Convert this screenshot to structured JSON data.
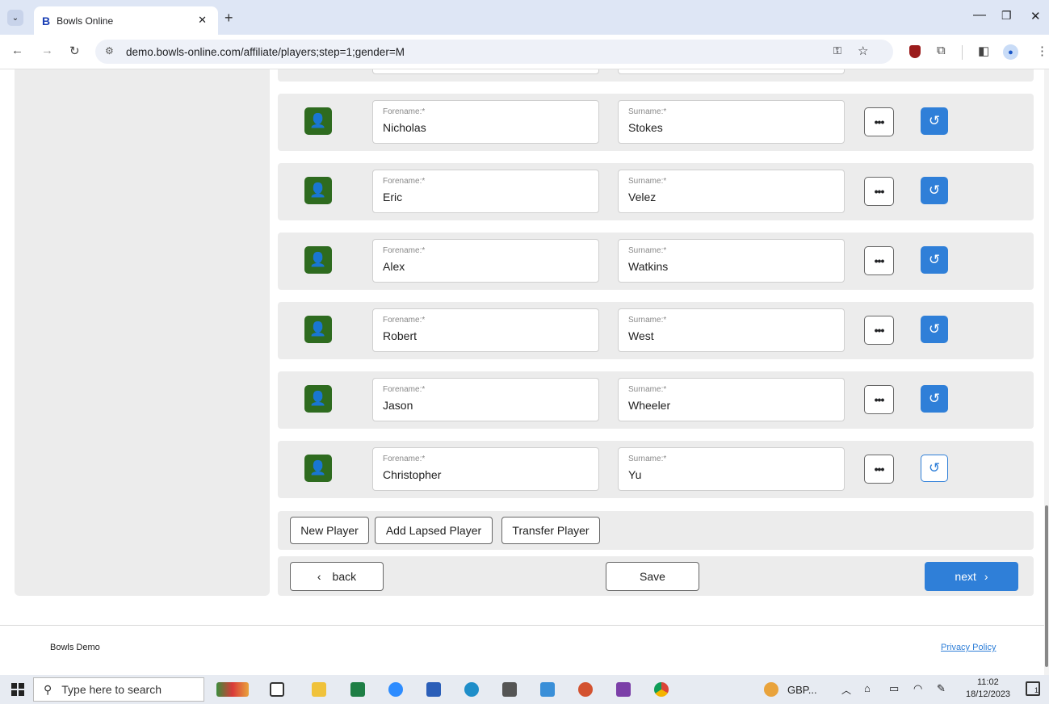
{
  "browser": {
    "tab_title": "Bowls Online",
    "tab_favicon": "B",
    "url": "demo.bowls-online.com/affiliate/players;step=1;gender=M",
    "new_tab": "+",
    "icons": [
      "tab-menu-icon",
      "back-arrow-icon",
      "forward-arrow-icon",
      "reload-icon",
      "site-info-icon",
      "password-key-icon",
      "bookmark-star-icon",
      "ublock-icon",
      "extensions-icon",
      "sidebar-icon",
      "profile-icon",
      "more-vert-icon",
      "minimize-icon",
      "restore-icon",
      "close-icon"
    ]
  },
  "players": {
    "forename_label": "Forename:*",
    "surname_label": "Surname:*",
    "more_label": "•••",
    "rows": [
      {
        "forename": "Nicholas",
        "surname": "Stokes",
        "undo_style": "filled"
      },
      {
        "forename": "Eric",
        "surname": "Velez",
        "undo_style": "filled"
      },
      {
        "forename": "Alex",
        "surname": "Watkins",
        "undo_style": "filled"
      },
      {
        "forename": "Robert",
        "surname": "West",
        "undo_style": "filled"
      },
      {
        "forename": "Jason",
        "surname": "Wheeler",
        "undo_style": "filled"
      },
      {
        "forename": "Christopher",
        "surname": "Yu",
        "undo_style": "outline"
      }
    ]
  },
  "actions": {
    "new_player": "New Player",
    "add_lapsed": "Add Lapsed Player",
    "transfer": "Transfer Player"
  },
  "nav": {
    "back": "back",
    "save": "Save",
    "next": "next"
  },
  "colors": {
    "player_icon": "#2e6b1f",
    "primary": "#2f7fd8"
  },
  "footer": {
    "brand": "Bowls Demo",
    "privacy": "Privacy Policy"
  },
  "taskbar": {
    "search_placeholder": "Type here to search",
    "tray_text": "GBP...",
    "time": "11:02",
    "date": "18/12/2023",
    "notification_count": "1"
  }
}
